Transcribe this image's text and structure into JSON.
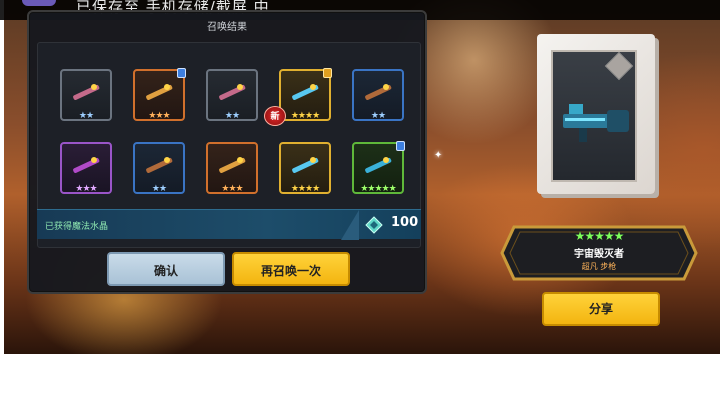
{
  "topbar": {
    "text": "已保存至 手机存储/截屏 中"
  },
  "panel": {
    "title": "召唤结果"
  },
  "slots": [
    {
      "rarity": "grey",
      "stars": "★★",
      "badge": false,
      "icon": "bow-icon"
    },
    {
      "rarity": "orange",
      "stars": "★★★",
      "badge": true,
      "icon": "armor-icon"
    },
    {
      "rarity": "grey",
      "stars": "★★",
      "badge": false,
      "icon": "rifle-icon"
    },
    {
      "rarity": "gold",
      "stars": "★★★★",
      "badge": true,
      "icon": "staff-icon"
    },
    {
      "rarity": "blue",
      "stars": "★★",
      "badge": false,
      "icon": "shotgun-icon"
    },
    {
      "rarity": "purple",
      "stars": "★★★",
      "badge": false,
      "icon": "shield-icon"
    },
    {
      "rarity": "blue",
      "stars": "★★",
      "badge": false,
      "icon": "wand-icon"
    },
    {
      "rarity": "orange",
      "stars": "★★★",
      "badge": false,
      "icon": "scepter-icon"
    },
    {
      "rarity": "gold",
      "stars": "★★★★",
      "badge": false,
      "icon": "orb-staff-icon"
    },
    {
      "rarity": "green",
      "stars": "★★★★★",
      "badge": true,
      "icon": "minigun-icon"
    }
  ],
  "new_tag": "新",
  "resource": {
    "label": "已获得魔法水晶",
    "value": "100",
    "icon": "crystal-icon"
  },
  "buttons": {
    "confirm": "确认",
    "again": "再召唤一次",
    "share": "分享"
  },
  "reward": {
    "stars": "★★★★★",
    "name": "宇宙毁灭者",
    "subtitle": "超凡 步枪",
    "icon": "minigun-icon"
  },
  "colors": {
    "gold": "#f3b510",
    "confirm": "#a9c2d6",
    "panel": "#16181e"
  }
}
